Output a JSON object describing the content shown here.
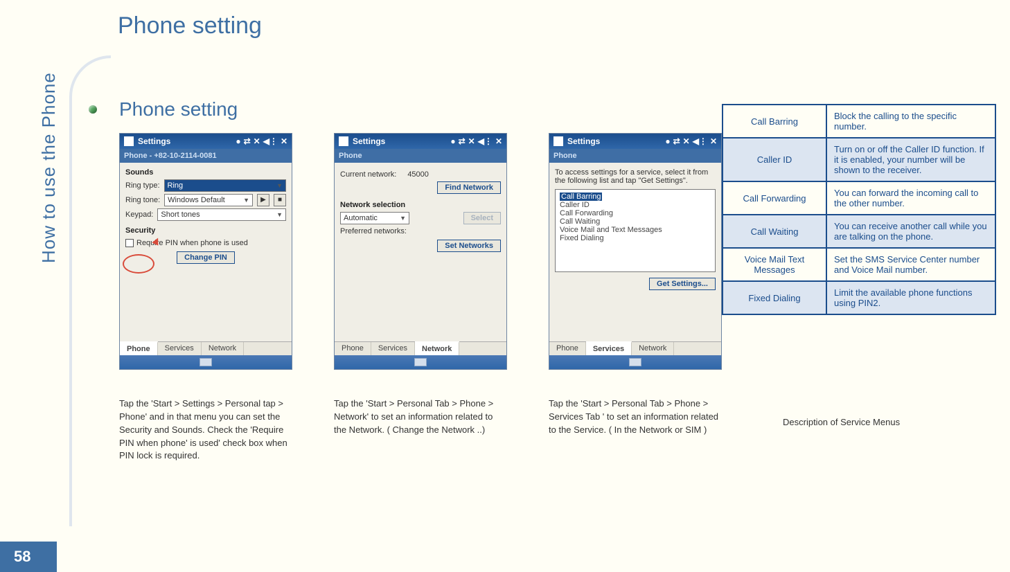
{
  "page": {
    "title": "Phone setting",
    "sideLabel": "How to use the Phone",
    "number": "58"
  },
  "section": {
    "title": "Phone setting"
  },
  "shot1": {
    "titlebar": "Settings",
    "subheader": "Phone - +82-10-2114-0081",
    "soundsHeading": "Sounds",
    "ringTypeLabel": "Ring type:",
    "ringTypeValue": "Ring",
    "ringToneLabel": "Ring tone:",
    "ringToneValue": "Windows Default",
    "keypadLabel": "Keypad:",
    "keypadValue": "Short tones",
    "securityHeading": "Security",
    "requirePin": "Require PIN when phone is used",
    "changePin": "Change PIN",
    "tabs": {
      "phone": "Phone",
      "services": "Services",
      "network": "Network"
    },
    "caption": "Tap the 'Start > Settings > Personal tap > Phone' and in that menu you can set the Security and Sounds. Check the 'Require PIN when phone' is used' check box when PIN lock is required."
  },
  "shot2": {
    "titlebar": "Settings",
    "subheader": "Phone",
    "curNetLabel": "Current network:",
    "curNetValue": "45000",
    "findNet": "Find Network",
    "netSelHeading": "Network selection",
    "netSelValue": "Automatic",
    "selectBtn": "Select",
    "prefNet": "Preferred networks:",
    "setNetworks": "Set Networks",
    "tabs": {
      "phone": "Phone",
      "services": "Services",
      "network": "Network"
    },
    "caption": "Tap the 'Start > Personal Tab > Phone > Network' to set an information related to the Network. ( Change the Network ..)"
  },
  "shot3": {
    "titlebar": "Settings",
    "subheader": "Phone",
    "instr": "To access settings for a service, select it from the following list and tap \"Get Settings\".",
    "items": {
      "barring": "Call Barring",
      "callerId": "Caller ID",
      "forwarding": "Call Forwarding",
      "waiting": "Call Waiting",
      "vmtext": "Voice Mail and Text Messages",
      "fixed": "Fixed Dialing"
    },
    "getSettings": "Get Settings...",
    "tabs": {
      "phone": "Phone",
      "services": "Services",
      "network": "Network"
    },
    "caption": "Tap the 'Start > Personal Tab > Phone > Services Tab ' to set an information related to the Service. ( In the Network or SIM )"
  },
  "services": [
    {
      "name": "Call Barring",
      "desc": "Block the calling to the specific number."
    },
    {
      "name": "Caller ID",
      "desc": "Turn on or off the Caller ID function. If it is enabled, your number will be shown to the receiver."
    },
    {
      "name": "Call Forwarding",
      "desc": "You can forward the incoming call to the other number."
    },
    {
      "name": "Call Waiting",
      "desc": "You can receive another call while you are talking on the phone."
    },
    {
      "name": "Voice Mail  Text Messages",
      "desc": "Set the SMS Service Center number and Voice Mail number."
    },
    {
      "name": "Fixed Dialing",
      "desc": "Limit the available phone functions using PIN2."
    }
  ],
  "servicesCaption": "Description of Service Menus",
  "icons": {
    "signal": "●",
    "sync": "⇄",
    "lock": "✕",
    "vol": "◀⋮",
    "close": "✕",
    "play": "▶",
    "stop": "■"
  }
}
